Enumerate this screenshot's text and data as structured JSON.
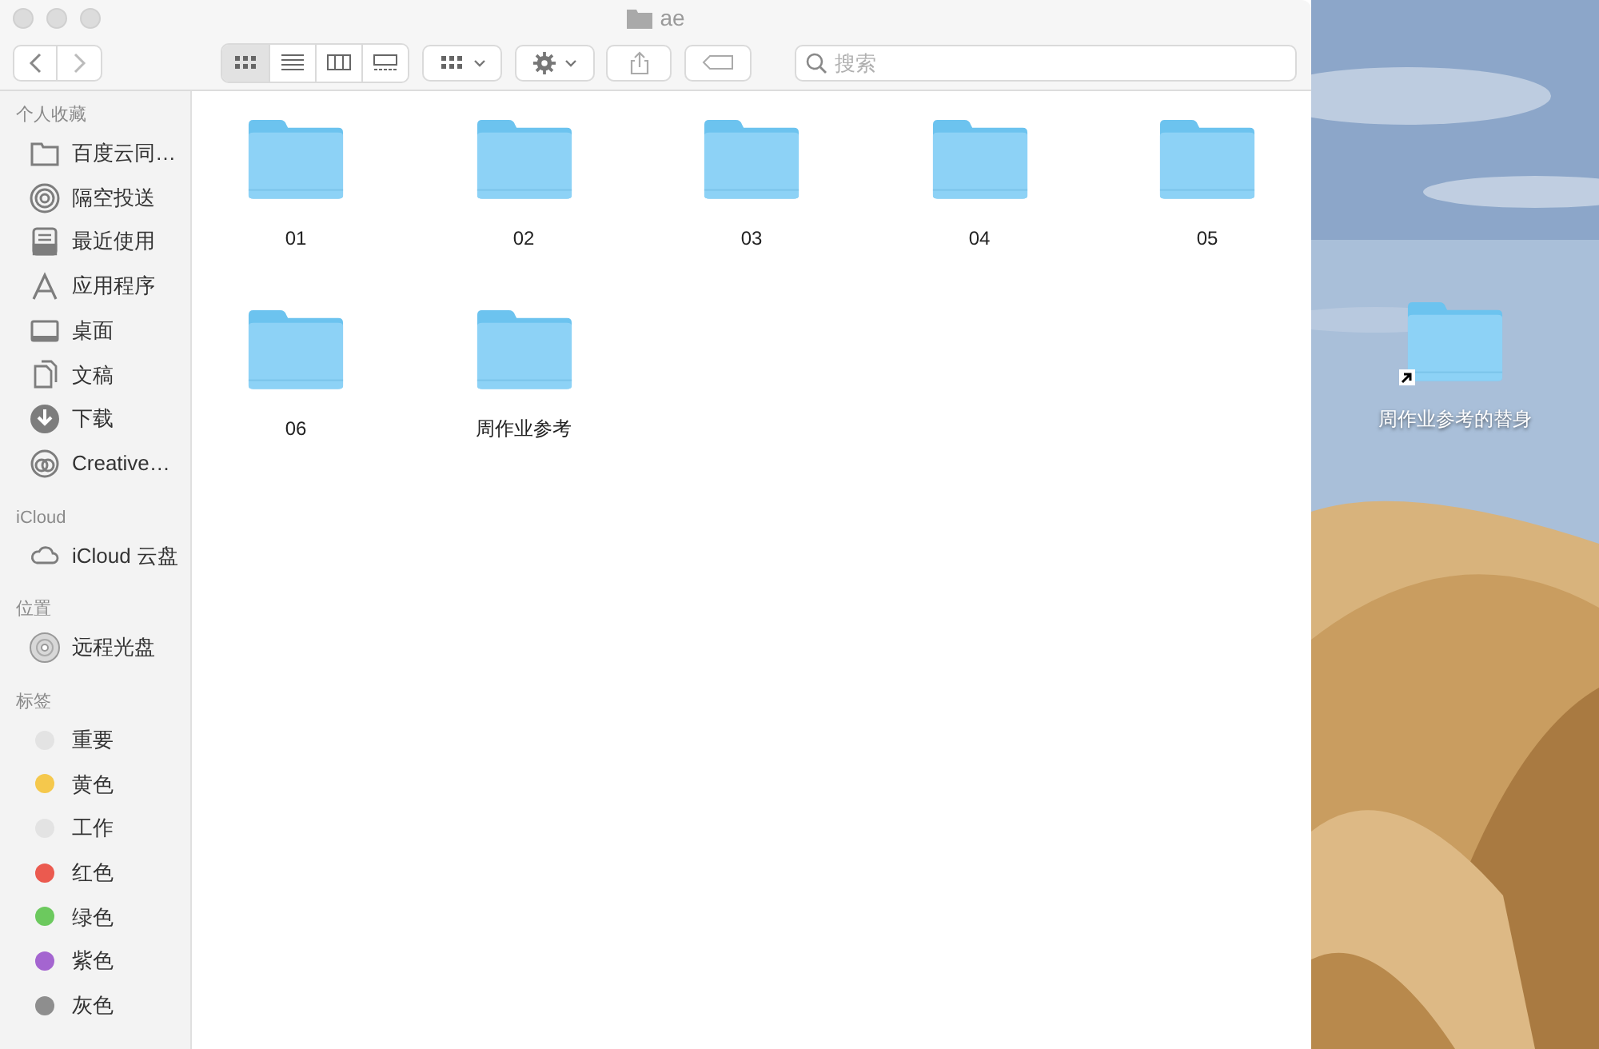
{
  "window": {
    "title": "ae"
  },
  "toolbar": {
    "view_buttons": [
      {
        "kind": "icons",
        "selected": true
      },
      {
        "kind": "list",
        "selected": false
      },
      {
        "kind": "columns",
        "selected": false
      },
      {
        "kind": "gallery",
        "selected": false
      }
    ],
    "search": {
      "placeholder": "搜索"
    }
  },
  "sidebar": {
    "sections": [
      {
        "heading": "个人收藏",
        "items": [
          {
            "label": "百度云同…",
            "kind": "folder"
          },
          {
            "label": "隔空投送",
            "kind": "airdrop"
          },
          {
            "label": "最近使用",
            "kind": "recents"
          },
          {
            "label": "应用程序",
            "kind": "apps"
          },
          {
            "label": "桌面",
            "kind": "desktop"
          },
          {
            "label": "文稿",
            "kind": "documents"
          },
          {
            "label": "下载",
            "kind": "downloads"
          },
          {
            "label": "Creative…",
            "kind": "creative"
          }
        ]
      },
      {
        "heading": "iCloud",
        "items": [
          {
            "label": "iCloud 云盘",
            "kind": "cloud"
          }
        ]
      },
      {
        "heading": "位置",
        "items": [
          {
            "label": "远程光盘",
            "kind": "disc"
          }
        ]
      },
      {
        "heading": "标签",
        "items": [
          {
            "label": "重要",
            "kind": "tag",
            "color": "#e3e3e3"
          },
          {
            "label": "黄色",
            "kind": "tag",
            "color": "#f5c84c"
          },
          {
            "label": "工作",
            "kind": "tag",
            "color": "#e3e3e3"
          },
          {
            "label": "红色",
            "kind": "tag",
            "color": "#eb5a4f"
          },
          {
            "label": "绿色",
            "kind": "tag",
            "color": "#6cc95e"
          },
          {
            "label": "紫色",
            "kind": "tag",
            "color": "#a465d0"
          },
          {
            "label": "灰色",
            "kind": "tag",
            "color": "#8e8e8e"
          }
        ]
      }
    ]
  },
  "folders": [
    {
      "name": "01"
    },
    {
      "name": "02"
    },
    {
      "name": "03"
    },
    {
      "name": "04"
    },
    {
      "name": "05"
    },
    {
      "name": "06"
    },
    {
      "name": "周作业参考"
    }
  ],
  "desktop_items": [
    {
      "name": "周作业参考的替身",
      "alias": true
    }
  ]
}
